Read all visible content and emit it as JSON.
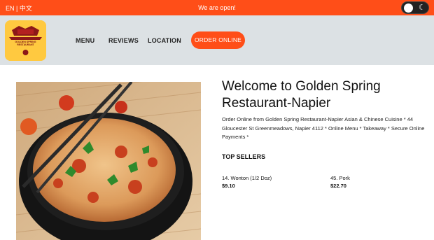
{
  "topbar": {
    "language": "EN | 中文",
    "status": "We are open!"
  },
  "logo": {
    "text": "GOLDEN SPRING RESTAURANT"
  },
  "nav": {
    "menu": "MENU",
    "reviews": "REVIEWS",
    "location": "LOCATION",
    "order_online": "ORDER ONLINE"
  },
  "main": {
    "title": "Welcome to Golden Spring Restaurant-Napier",
    "description": "Order Online from Golden Spring Restaurant-Napier Asian & Chinese Cuisine * 44 Gloucester St Greenmeadows, Napier 4112 * Online Menu * Takeaway * Secure Online Payments *",
    "top_sellers_heading": "TOP SELLERS",
    "top_sellers": [
      {
        "name": "14. Wonton (1/2 Doz)",
        "price": "$9.10"
      },
      {
        "name": "45. Pork",
        "price": "$22.70"
      }
    ]
  },
  "colors": {
    "brand": "#ff4e18",
    "header_bg": "#dce1e4",
    "logo_bg": "#ffc940"
  },
  "icons": {
    "theme_toggle": "moon-icon"
  }
}
